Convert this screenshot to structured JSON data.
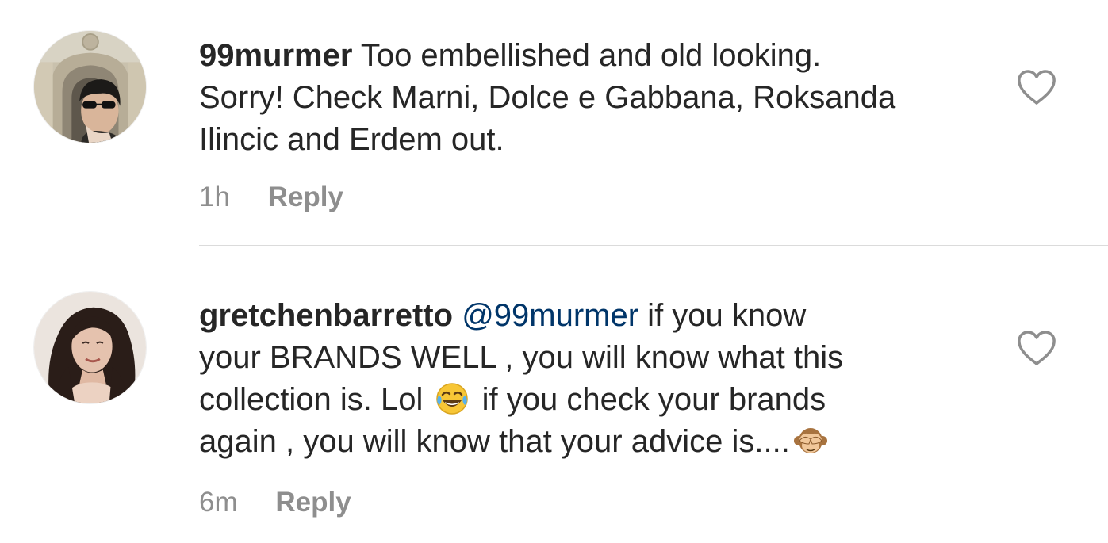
{
  "comments": [
    {
      "username": "99murmer",
      "text_line1": "Too embellished and old looking.",
      "text_line2": "Sorry!  Check Marni, Dolce e Gabbana, Roksanda",
      "text_line3": "Ilincic and Erdem out.",
      "time": "1h",
      "reply_label": "Reply",
      "avatar_icon": "profile-photo-arch-sunglasses",
      "like_icon": "heart-outline-icon"
    },
    {
      "username": "gretchenbarretto",
      "mention": "@99murmer",
      "text_seg1": " if you know",
      "text_line2": "your BRANDS WELL , you will know what this",
      "text_line3a": "collection is. Lol ",
      "emoji1": "face-with-tears-of-joy",
      "text_line3b": " if you check your brands",
      "text_line4": "again , you will know that your advice is....",
      "emoji2": "see-no-evil-monkey",
      "time": "6m",
      "reply_label": "Reply",
      "avatar_icon": "profile-photo-woman-dark-hair",
      "like_icon": "heart-outline-icon"
    }
  ],
  "colors": {
    "text": "#262626",
    "meta": "#8e8e8e",
    "mention": "#003569",
    "divider": "#dbdbdb"
  }
}
